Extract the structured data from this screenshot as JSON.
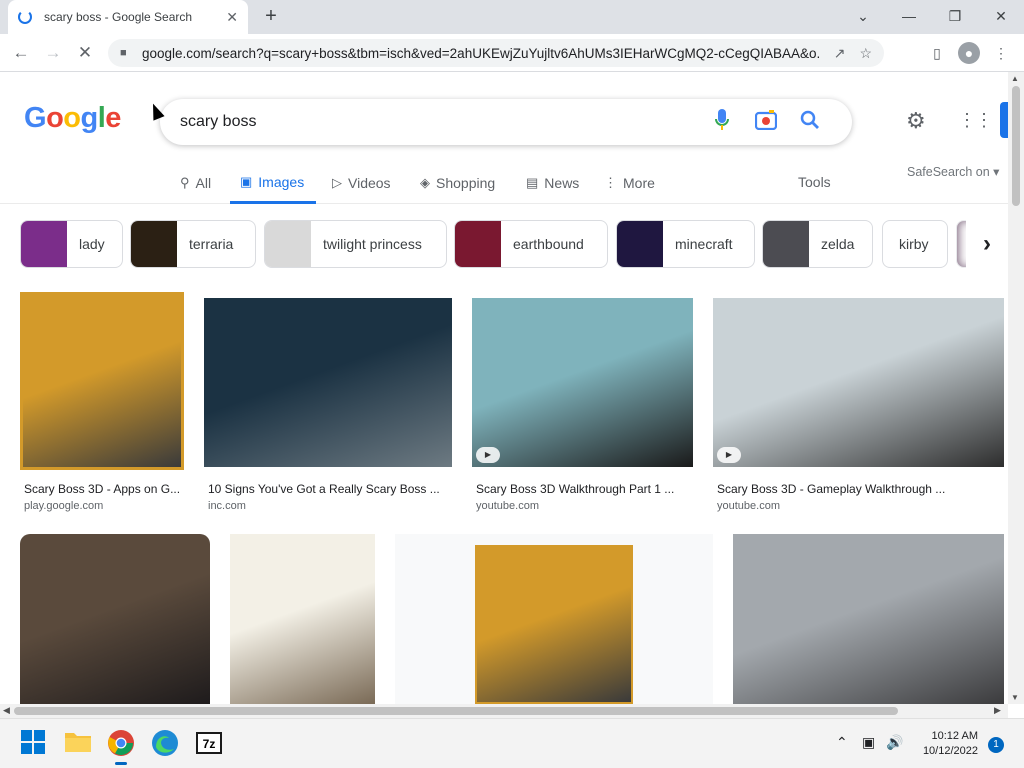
{
  "browser": {
    "tab_title": "scary boss - Google Search",
    "tab_close": "✕",
    "newtab": "+",
    "url": "google.com/search?q=scary+boss&tbm=isch&ved=2ahUKEwjZuYujltv6AhUMs3IEHarWCgMQ2-cCegQIABAA&o...",
    "win_controls": [
      "⌄",
      "—",
      "❐",
      "✕"
    ]
  },
  "search": {
    "query": "scary boss"
  },
  "logo": [
    "G",
    "o",
    "o",
    "g",
    "l",
    "e"
  ],
  "navtabs": [
    {
      "label": "All",
      "icon": "search-icon"
    },
    {
      "label": "Images",
      "icon": "image-icon",
      "active": true
    },
    {
      "label": "Videos",
      "icon": "video-icon"
    },
    {
      "label": "Shopping",
      "icon": "tag-icon"
    },
    {
      "label": "News",
      "icon": "news-icon"
    },
    {
      "label": "More",
      "icon": "dots-vertical-icon"
    }
  ],
  "tools_label": "Tools",
  "safesearch_label": "SafeSearch on ▾",
  "chips": [
    {
      "label": "lady",
      "thumb_color": "#7b2d8a"
    },
    {
      "label": "terraria",
      "thumb_color": "#2b2014"
    },
    {
      "label": "twilight princess",
      "thumb_color": "#d9d9d9"
    },
    {
      "label": "earthbound",
      "thumb_color": "#7a1830"
    },
    {
      "label": "minecraft",
      "thumb_color": "#1f1740"
    },
    {
      "label": "zelda",
      "thumb_color": "#4c4c52"
    },
    {
      "label": "kirby",
      "thumb_color": null
    }
  ],
  "results_row1": [
    {
      "caption": "Scary Boss 3D - Apps on G...",
      "source": "play.google.com",
      "colors": [
        "#d39a2a",
        "#3a3a3a"
      ],
      "video": false
    },
    {
      "caption": "10 Signs You've Got a Really Scary Boss ...",
      "source": "inc.com",
      "colors": [
        "#1b3243",
        "#6d7a82"
      ],
      "video": false
    },
    {
      "caption": "Scary Boss 3D Walkthrough Part 1 ...",
      "source": "youtube.com",
      "colors": [
        "#7fb3bc",
        "#1a1a1a"
      ],
      "video": true
    },
    {
      "caption": "Scary Boss 3D - Gameplay Walkthrough ...",
      "source": "youtube.com",
      "colors": [
        "#c9d2d6",
        "#2d2d2d"
      ],
      "video": true
    }
  ],
  "results_row2": [
    {
      "colors": [
        "#5a4a3c",
        "#1e1b1c"
      ]
    },
    {
      "colors": [
        "#f3f0e6",
        "#7a6a56"
      ]
    },
    {
      "colors": [
        "#d39a2a",
        "#3a3a3a"
      ]
    },
    {
      "colors": [
        "#a3a8ad",
        "#3b3b3d"
      ]
    }
  ],
  "taskbar": {
    "time": "10:12 AM",
    "date": "10/12/2022",
    "notifications": "1"
  }
}
